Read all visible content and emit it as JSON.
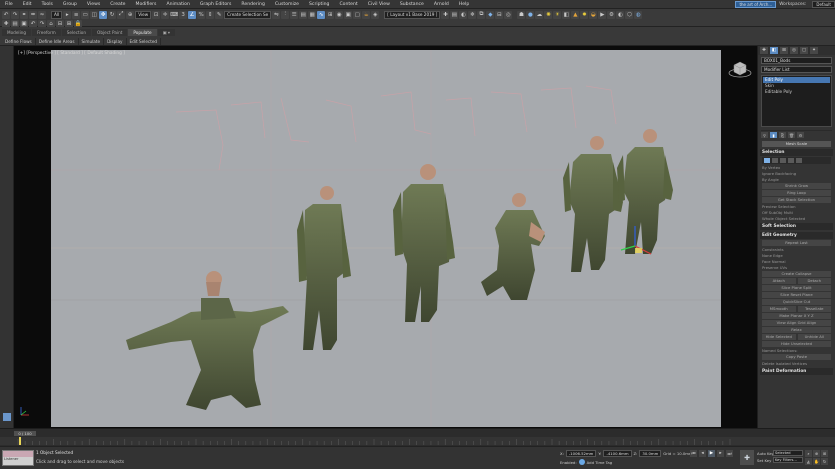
{
  "menu": {
    "items": [
      "File",
      "Edit",
      "Tools",
      "Group",
      "Views",
      "Create",
      "Modifiers",
      "Animation",
      "Graph Editors",
      "Rendering",
      "Customize",
      "Scripting",
      "Content",
      "Civil View",
      "Substance",
      "Arnold",
      "Help"
    ],
    "search_box": "the art of Arch...",
    "user": "Workspaces:",
    "workspace": "Default"
  },
  "toolbar": {
    "filter_all": "All",
    "view_dropdown": "View",
    "selection_set": "Create Selection Se",
    "tb_search": "Create Selection Se",
    "layers_dropdown": "[ Layout v1 Base 2019 ]"
  },
  "ribbon": {
    "tabs": [
      "Modeling",
      "Freeform",
      "Selection",
      "Object Paint",
      "Populate"
    ],
    "active_tab": 4,
    "sub_items": [
      "Define Flows",
      "Define Idle Areas",
      "Simulate",
      "Display",
      "Edit Selected"
    ]
  },
  "viewport": {
    "label": "[+] [Perspective ] [ Standard ] [ Default Shading ]"
  },
  "command_panel": {
    "object_name": "BOX01_Bods",
    "modifier_list_label": "Modifier List",
    "stack": [
      {
        "label": "Edit Poly",
        "selected": true
      },
      {
        "label": "Skin",
        "selected": false
      },
      {
        "label": "Editable Poly",
        "selected": false
      }
    ],
    "header_btn": "Mesh Scale",
    "rollouts": {
      "selection": "Selection",
      "soft_selection": "Soft Selection",
      "edit_geometry": "Edit Geometry",
      "paint_deformation": "Paint Deformation"
    },
    "sel_lines": [
      "By Vertex",
      "Ignore Backfacing",
      "By Angle",
      "Shrink  Grow",
      "Ring  Loop",
      "Get Stack Selection",
      "Preview Selection",
      "Off  SubObj  Multi",
      "Whole Object Selected"
    ],
    "edit_geo": [
      "Repeat Last",
      "Constraints",
      "None  Edge",
      "Face  Normal",
      "Preserve UVs",
      "Create  Collapse",
      "Attach",
      "Detach",
      "Slice Plane  Split",
      "Slice  Reset Plane",
      "QuickSlice  Cut",
      "MSmooth",
      "Tessellate",
      "Make Planar  X Y Z",
      "View Align  Grid Align",
      "Relax",
      "Hide Selected",
      "Unhide All",
      "Hide Unselected",
      "Named Selections:",
      "Copy  Paste",
      "Delete Isolated Vertices"
    ]
  },
  "timeline": {
    "slider": "0 / 100"
  },
  "status": {
    "maxscript_line": "Listener",
    "objects_selected": "1 Object Selected",
    "prompt": "Click and drag to select and move objects",
    "x_label": "X:",
    "x_value": "-1006.52mm",
    "y_label": "Y:",
    "y_value": "-4100.6mm",
    "z_label": "Z:",
    "z_value": "30.0mm",
    "grid": "Grid = 10.0mm",
    "enabled": "Enabled:",
    "add_time_tag": "Add Time Tag",
    "autokey": "Auto Key",
    "selected": "Selected",
    "set_key": "Set Key",
    "key_filters": "Key Filters...",
    "frame": "0"
  },
  "icons": [
    "undo-icon",
    "redo-icon",
    "link-icon",
    "unlink-icon",
    "select-icon",
    "move-icon",
    "rotate-icon",
    "scale-icon",
    "snap-icon",
    "angle-snap-icon",
    "mirror-icon",
    "align-icon",
    "render-icon",
    "teapot-icon",
    "play-icon",
    "key-icon"
  ],
  "colors": {
    "accent": "#5e8dc4",
    "viewport_bg": "#a7aaae",
    "active_modifier": "#4677b2",
    "autokey_red": "#a03030"
  }
}
